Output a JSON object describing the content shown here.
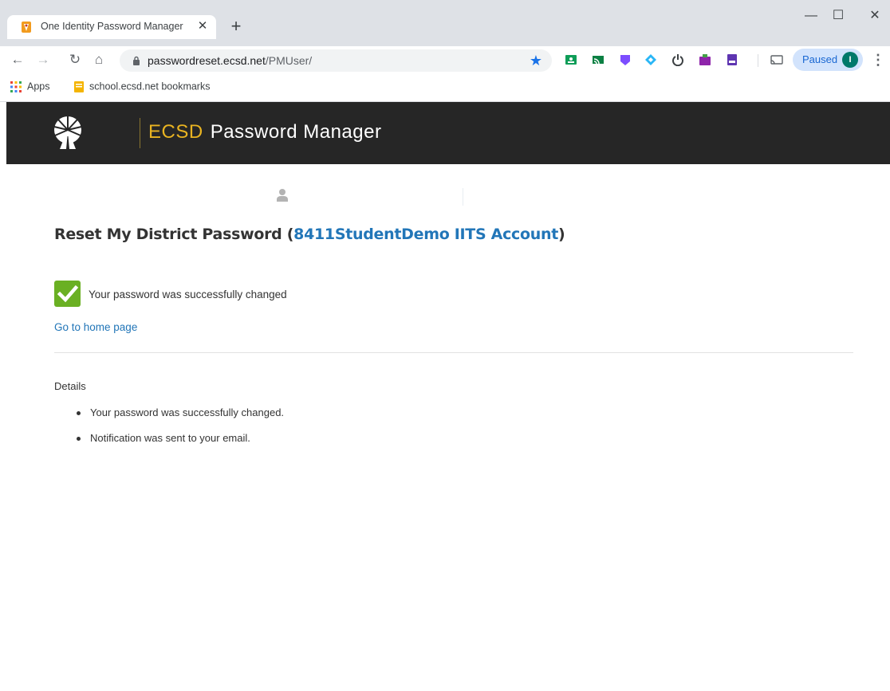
{
  "browser": {
    "tab_title": "One Identity Password Manager",
    "new_tab_label": "+",
    "url_domain": "passwordreset.ecsd.net",
    "url_path": "/PMUser/",
    "profile_label": "Paused",
    "profile_initial": "I",
    "bookmarks": [
      {
        "label": "Apps",
        "icon": "apps-grid-icon"
      },
      {
        "label": "school.ecsd.net bookmarks",
        "icon": "folder-icon"
      }
    ]
  },
  "header": {
    "brand_accent": "ECSD",
    "brand_rest": "Password Manager",
    "accent_color": "#e8b321",
    "background_color": "#262626"
  },
  "main": {
    "heading_prefix": "Reset My District Password (",
    "account_name": "8411StudentDemo IITS Account",
    "heading_suffix": ")",
    "success_message": "Your password was successfully changed",
    "home_link": "Go to home page",
    "details_label": "Details",
    "details_items": [
      "Your password was successfully changed.",
      "Notification was sent to your email."
    ],
    "success_color": "#6ab023",
    "link_color": "#2276b8"
  }
}
